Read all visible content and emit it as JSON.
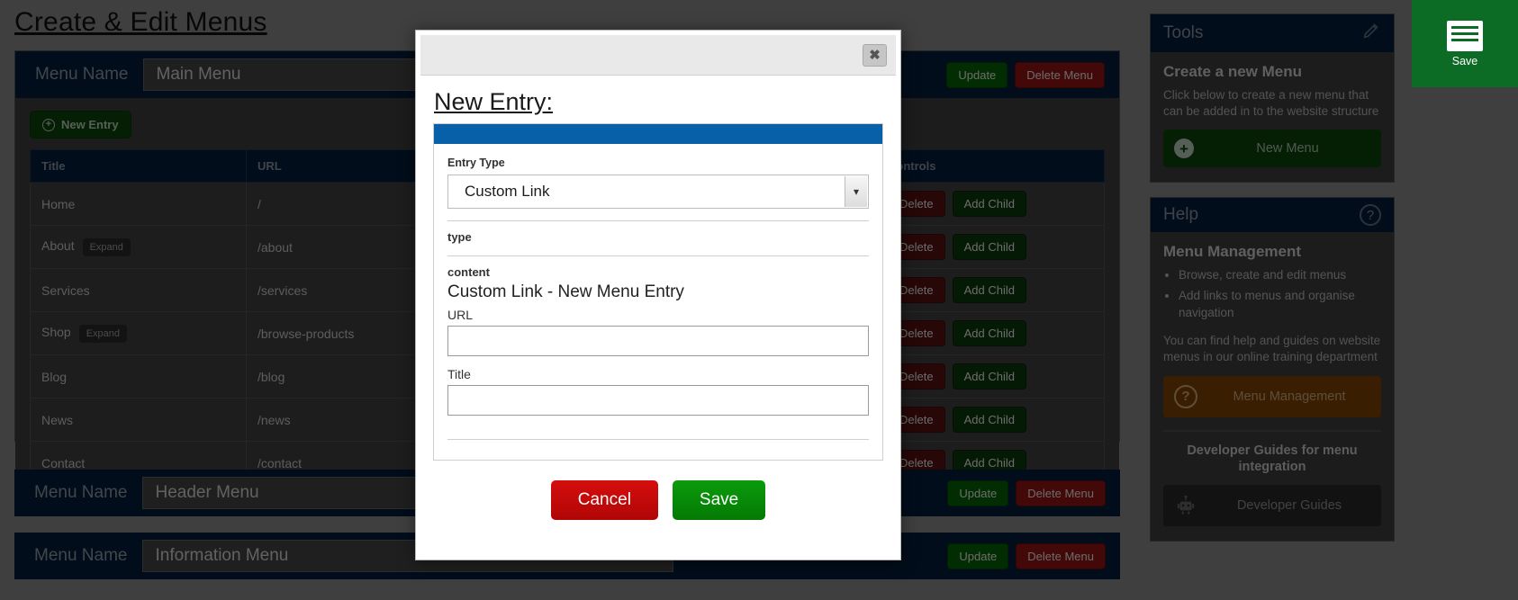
{
  "page": {
    "title": "Create & Edit Menus"
  },
  "menus": [
    {
      "name_label": "Menu Name",
      "name_value": "Main Menu",
      "new_entry_label": "New Entry",
      "columns": [
        "Title",
        "URL",
        "Controls"
      ],
      "rows": [
        {
          "title": "Home",
          "tag": "",
          "url": "/",
          "delete": "Delete",
          "add_child": "Add Child"
        },
        {
          "title": "About",
          "tag": "Expand",
          "url": "/about",
          "delete": "Delete",
          "add_child": "Add Child"
        },
        {
          "title": "Services",
          "tag": "",
          "url": "/services",
          "delete": "Delete",
          "add_child": "Add Child"
        },
        {
          "title": "Shop",
          "tag": "Expand",
          "url": "/browse-products",
          "delete": "Delete",
          "add_child": "Add Child"
        },
        {
          "title": "Blog",
          "tag": "",
          "url": "/blog",
          "delete": "Delete",
          "add_child": "Add Child"
        },
        {
          "title": "News",
          "tag": "",
          "url": "/news",
          "delete": "Delete",
          "add_child": "Add Child"
        },
        {
          "title": "Contact",
          "tag": "",
          "url": "/contact",
          "delete": "Delete",
          "add_child": "Add Child"
        }
      ]
    },
    {
      "name_label": "Menu Name",
      "name_value": "Header Menu",
      "update_label": "Update",
      "delete_menu_label": "Delete Menu"
    },
    {
      "name_label": "Menu Name",
      "name_value": "Information Menu",
      "update_label": "Update",
      "delete_menu_label": "Delete Menu"
    }
  ],
  "sidebar": {
    "tools": {
      "heading": "Tools",
      "edit_icon": "pencil-icon",
      "section_title": "Create a new Menu",
      "section_text": "Click below to create a new menu that can be added in to the website structure",
      "button_label": "New Menu"
    },
    "help": {
      "heading": "Help",
      "help_icon": "question-circle-icon",
      "section_title": "Menu Management",
      "bullets": [
        "Browse, create and edit menus",
        "Add links to menus and organise navigation"
      ],
      "paragraph": "You can find help and guides on website menus in our online training department",
      "button_label": "Menu Management",
      "guides_title": "Developer Guides for menu integration",
      "guides_button_label": "Developer Guides"
    }
  },
  "save_widget": {
    "icon": "document-save-icon",
    "label": "Save"
  },
  "modal": {
    "close_label": "✖",
    "title": "New Entry:",
    "accent_color": "#0860a8",
    "entry_type_label": "Entry Type",
    "entry_type_value": "Custom Link",
    "type_label": "type",
    "content_label": "content",
    "content_value": "Custom Link - New Menu Entry",
    "url_label": "URL",
    "url_value": "",
    "url_placeholder": "",
    "title_label": "Title",
    "title_value": "",
    "title_placeholder": "",
    "cancel_label": "Cancel",
    "save_label": "Save"
  }
}
